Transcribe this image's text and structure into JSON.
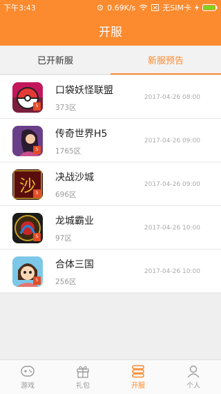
{
  "status_bar": {
    "time": "下午3:43",
    "speed": "0.69K/s",
    "sim": "无SIM卡"
  },
  "header": {
    "title": "开服"
  },
  "tabs": [
    {
      "label": "已开新服",
      "active": false
    },
    {
      "label": "新服预告",
      "active": true
    }
  ],
  "servers": [
    {
      "name": "口袋妖怪联盟",
      "server": "373区",
      "date": "2017-04-26 08:00",
      "icon": "pokeball-game-icon",
      "h5": "5"
    },
    {
      "name": "传奇世界H5",
      "server": "1765区",
      "date": "2017-04-26 09:00",
      "icon": "legend-world-game-icon",
      "h5": "5"
    },
    {
      "name": "决战沙城",
      "server": "696区",
      "date": "2017-04-26 09:00",
      "icon": "sha-city-game-icon",
      "h5": "5"
    },
    {
      "name": "龙城霸业",
      "server": "97区",
      "date": "2017-04-26 10:00",
      "icon": "dragon-city-game-icon",
      "h5": "5"
    },
    {
      "name": "合体三国",
      "server": "256区",
      "date": "2017-04-26 10:00",
      "icon": "three-kingdoms-game-icon",
      "h5": "5"
    }
  ],
  "bottom_nav": [
    {
      "label": "游戏",
      "icon": "gamepad-icon",
      "active": false
    },
    {
      "label": "礼包",
      "icon": "gift-icon",
      "active": false
    },
    {
      "label": "开服",
      "icon": "server-stack-icon",
      "active": true
    },
    {
      "label": "个人",
      "icon": "person-icon",
      "active": false
    }
  ],
  "colors": {
    "accent": "#fc8a2e",
    "text": "#222222",
    "muted": "#999999"
  }
}
